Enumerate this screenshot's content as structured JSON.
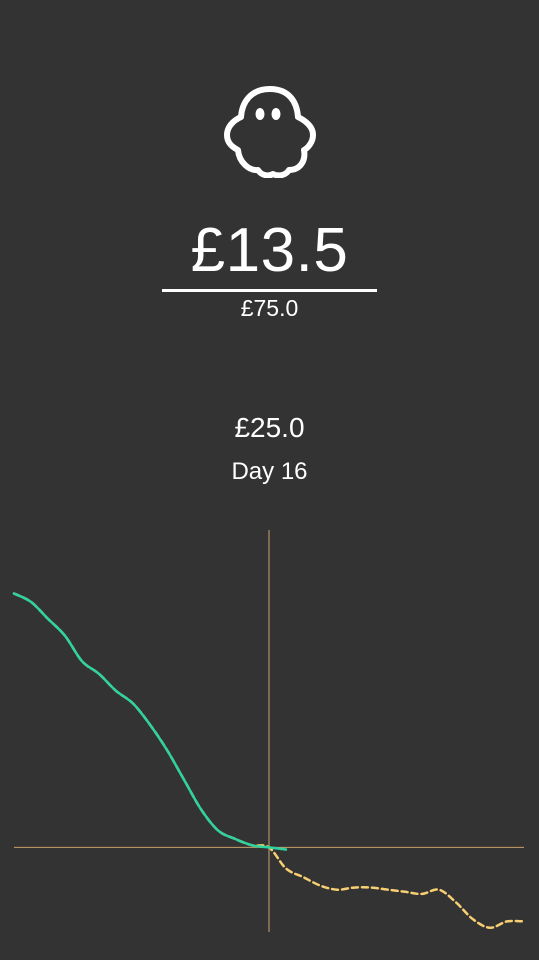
{
  "icon": "ghost-icon",
  "balance": {
    "amount": "£13.5",
    "budget": "£75.0"
  },
  "selection": {
    "amount": "£25.0",
    "day_label": "Day 16"
  },
  "colors": {
    "background": "#333333",
    "actual_line": "#2dd4a0",
    "projected_line": "#f7cf72",
    "crosshair": "#c9a06a",
    "text": "#ffffff"
  },
  "chart_data": {
    "type": "line",
    "title": "",
    "xlabel": "",
    "ylabel": "",
    "xlim": [
      1,
      31
    ],
    "ylim": [
      -20,
      75
    ],
    "selected_day": 16,
    "series": [
      {
        "style": "solid",
        "x": [
          1,
          2,
          3,
          4,
          5,
          6,
          7,
          8,
          9,
          10,
          11,
          12,
          13,
          14,
          15,
          16,
          17
        ],
        "y": [
          60,
          58,
          54,
          50,
          44,
          41,
          37,
          34,
          29,
          23,
          16,
          9,
          4,
          2,
          0.5,
          0,
          -0.5
        ]
      },
      {
        "style": "dashed",
        "x": [
          1,
          2,
          3,
          4,
          5,
          6,
          7,
          8,
          9,
          10,
          11,
          12,
          13,
          14,
          15,
          16,
          17,
          18,
          19,
          20,
          21,
          22,
          23,
          24,
          25,
          26,
          27,
          28,
          29,
          30,
          31
        ],
        "y": [
          60,
          58,
          54,
          50,
          44,
          41,
          37,
          34,
          29,
          23,
          16,
          9,
          4,
          2,
          0.5,
          0,
          -5,
          -7,
          -9,
          -10,
          -9.5,
          -9.5,
          -10,
          -10.5,
          -11,
          -10,
          -13,
          -17,
          -19,
          -17.5,
          -17.5
        ]
      }
    ]
  }
}
